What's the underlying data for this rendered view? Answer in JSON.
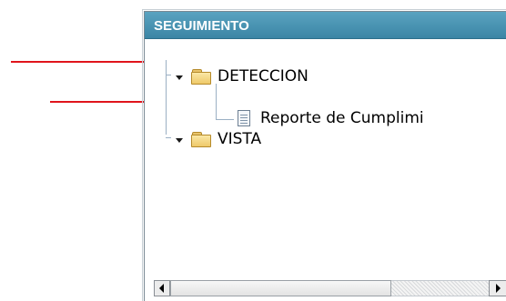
{
  "panel": {
    "title": "SEGUIMIENTO"
  },
  "tree": {
    "nodes": [
      {
        "label": "DETECCION",
        "icon": "folder-icon",
        "expanded": true,
        "children": [
          {
            "label": "Reporte de Cumplimi",
            "icon": "document-icon"
          }
        ]
      },
      {
        "label": "VISTA",
        "icon": "folder-icon",
        "expanded": true,
        "children": []
      }
    ]
  },
  "annotations": {
    "arrow_color": "#e0141c"
  },
  "colors": {
    "header_bg": "#4a96b6",
    "header_text": "#ffffff",
    "tree_line": "#9bb0c4"
  }
}
